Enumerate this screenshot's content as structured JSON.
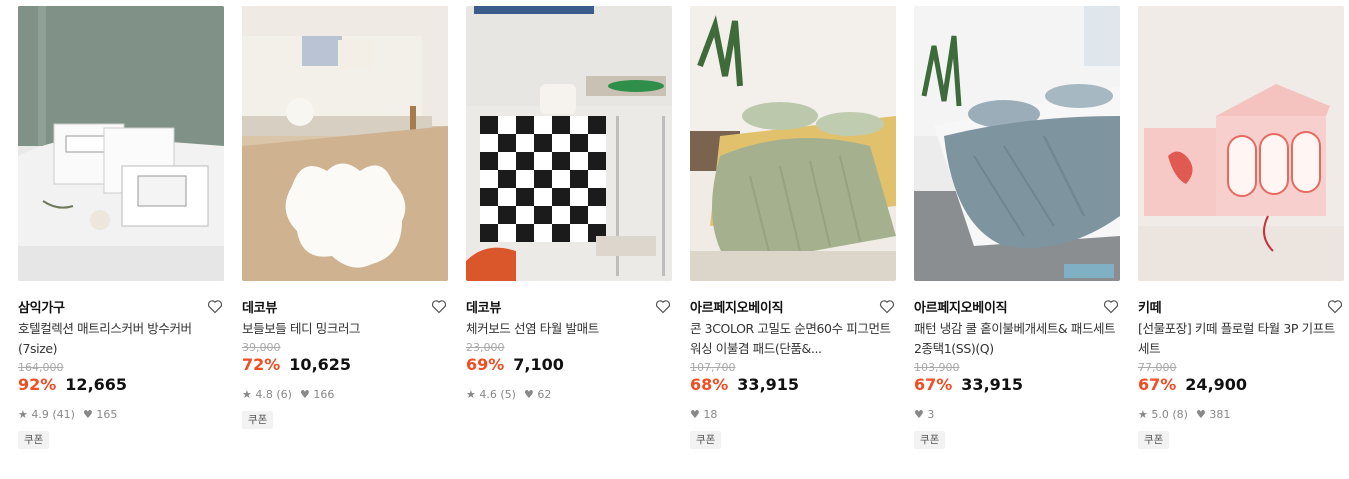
{
  "products": [
    {
      "brand": "삼익가구",
      "title": "호텔컬렉션 매트리스커버 방수커버 (7size)",
      "original_price": "164,000",
      "discount": "92%",
      "price": "12,665",
      "rating": "4.9 (41)",
      "likes": "165",
      "badge": "쿠폰",
      "image": "hotel-mattress-cover-photo"
    },
    {
      "brand": "데코뷰",
      "title": "보들보들 테디 밍크러그",
      "original_price": "39,000",
      "discount": "72%",
      "price": "10,625",
      "rating": "4.8 (6)",
      "likes": "166",
      "badge": "쿠폰",
      "image": "teddy-rug-photo"
    },
    {
      "brand": "데코뷰",
      "title": "체커보드 선염 타월 발매트",
      "original_price": "23,000",
      "discount": "69%",
      "price": "7,100",
      "rating": "4.6 (5)",
      "likes": "62",
      "badge": null,
      "image": "checkerboard-mat-photo"
    },
    {
      "brand": "아르페지오베이직",
      "title": "콘 3COLOR 고밀도 순면60수 피그먼트워싱 이불겸 패드(단품&...",
      "original_price": "107,700",
      "discount": "68%",
      "price": "33,915",
      "rating": null,
      "likes": "18",
      "badge": "쿠폰",
      "image": "green-blanket-photo"
    },
    {
      "brand": "아르페지오베이직",
      "title": "패턴 냉감 쿨 홑이불베개세트& 패드세트 2종택1(SS)(Q)",
      "original_price": "103,900",
      "discount": "67%",
      "price": "33,915",
      "rating": null,
      "likes": "3",
      "badge": "쿠폰",
      "image": "cool-bedding-photo"
    },
    {
      "brand": "키떼",
      "title": "[선물포장] 키떼 플로럴 타월 3P 기프트 세트",
      "original_price": "77,000",
      "discount": "67%",
      "price": "24,900",
      "rating": "5.0 (8)",
      "likes": "381",
      "badge": "쿠폰",
      "image": "towel-gift-set-photo"
    }
  ],
  "icons": {
    "wishlist": "heart-outline-icon",
    "rating": "star-icon",
    "likes": "heart-filled-icon"
  },
  "colors": {
    "discount": "#f04e23",
    "badge_bg": "#f2f2f2"
  }
}
